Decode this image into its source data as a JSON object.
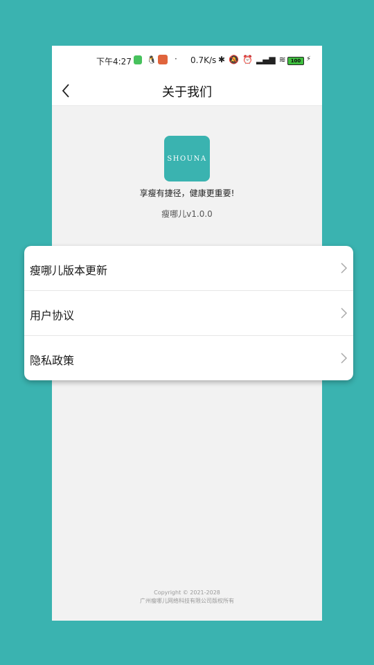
{
  "status_bar": {
    "time": "下午4:27",
    "network_speed": "0.7K/s",
    "battery": "100"
  },
  "header": {
    "title": "关于我们"
  },
  "about": {
    "logo_text": "SHOUNA",
    "slogan": "享瘦有捷径，健康更重要!",
    "version": "瘦哪儿v1.0.0"
  },
  "menu": {
    "items": [
      {
        "label": "瘦哪儿版本更新"
      },
      {
        "label": "用户协议"
      },
      {
        "label": "隐私政策"
      }
    ]
  },
  "footer": {
    "copyright_line1": "Copyright © 2021-2028",
    "copyright_line2": "广州瘦哪儿网络科技有限公司版权所有"
  },
  "colors": {
    "brand": "#3ab3b0"
  }
}
